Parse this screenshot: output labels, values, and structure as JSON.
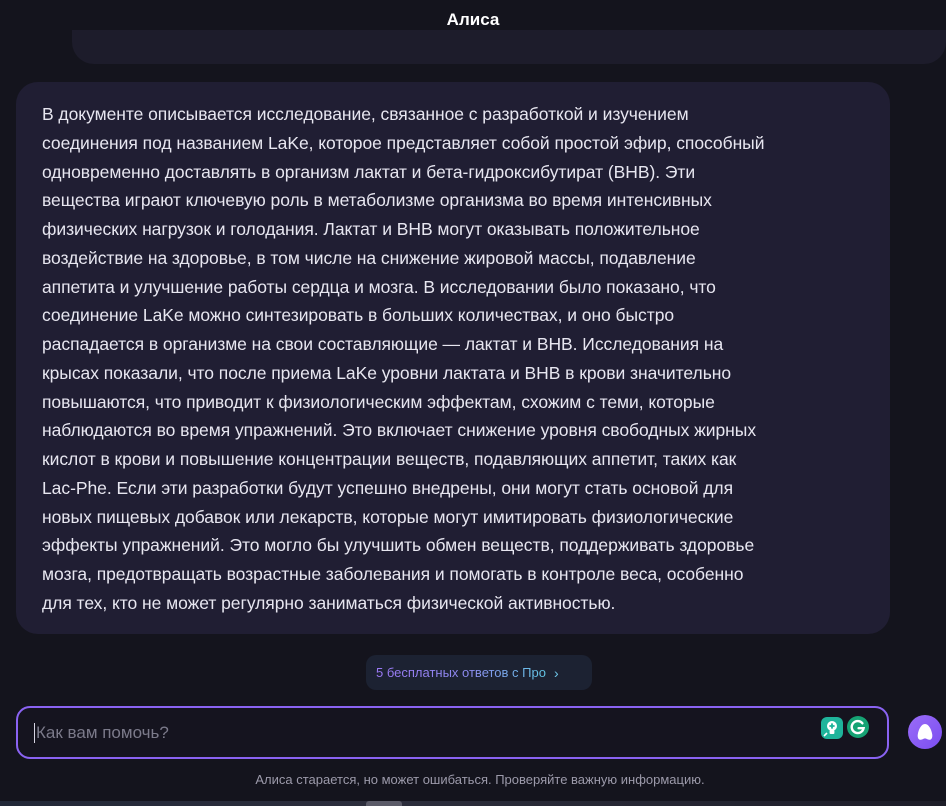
{
  "header": {
    "title": "Алиса"
  },
  "message": {
    "lines": [
      "В документе описывается исследование, связанное с разработкой и изучением",
      "соединения под названием LaKe, которое представляет собой простой эфир, способный",
      "одновременно доставлять в организм лактат и бета-гидроксибутират (BHB). Эти",
      "вещества играют ключевую роль в метаболизме организма во время интенсивных",
      "физических нагрузок и голодания. Лактат и BHB могут оказывать положительное",
      "воздействие на здоровье, в том числе на снижение жировой массы, подавление",
      "аппетита и улучшение работы сердца и мозга. В исследовании было показано, что",
      "соединение LaKe можно синтезировать в больших количествах, и оно быстро",
      "распадается в организме на свои составляющие — лактат и BHB. Исследования на",
      "крысах показали, что после приема LaKe уровни лактата и BHB в крови значительно",
      "повышаются, что приводит к физиологическим эффектам, схожим с теми, которые",
      "наблюдаются во время упражнений. Это включает снижение уровня свободных жирных",
      "кислот в крови и повышение концентрации веществ, подавляющих аппетит, таких как",
      "Lac-Phe. Если эти разработки будут успешно внедрены, они могут стать основой для",
      "новых пищевых добавок или лекарств, которые могут имитировать физиологические",
      "эффекты упражнений. Это могло бы улучшить обмен веществ, поддерживать здоровье",
      "мозга, предотвращать возрастные заболевания и помогать в контроле веса, особенно",
      "для тех, кто не может регулярно заниматься физической активностью."
    ]
  },
  "pro_offer": {
    "label": "5 бесплатных ответов с Про",
    "chevron_icon": "chevron-right-icon"
  },
  "input": {
    "placeholder": "Как вам помочь?",
    "value": ""
  },
  "icons": {
    "grammar_icon": "lightbulb-plus-icon",
    "grammarly_icon": "grammarly-g-icon",
    "assistant_icon": "alice-icon"
  },
  "footer": {
    "disclaimer": "Алиса старается, но может ошибаться. Проверяйте важную информацию."
  },
  "colors": {
    "accent": "#8a63f2",
    "background": "#14141d",
    "bubble": "#201e33",
    "text": "#e7e6f0"
  }
}
